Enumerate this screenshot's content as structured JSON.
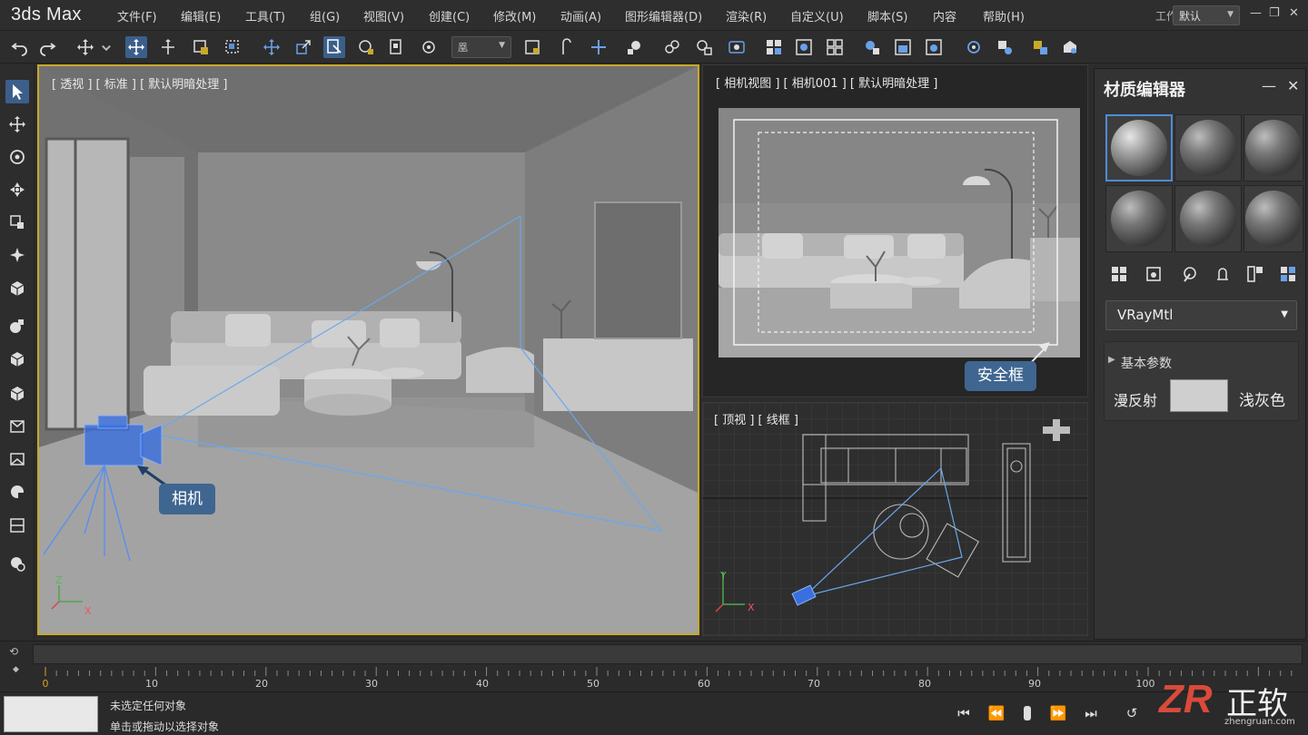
{
  "app": {
    "title": "3ds Max"
  },
  "menus": [
    "文件(F)",
    "编辑(E)",
    "工具(T)",
    "组(G)",
    "视图(V)",
    "创建(C)",
    "修改(M)",
    "动画(A)",
    "图形编辑器(D)",
    "渲染(R)",
    "自定义(U)",
    "脚本(S)",
    "内容",
    "帮助(H)"
  ],
  "workspace": {
    "label": "工作区:",
    "value": "默认"
  },
  "toolbar": {
    "selection_set": "凰"
  },
  "viewports": {
    "perspective": {
      "label": "[ 透视 ] [ 标准 ] [ 默认明暗处理 ]",
      "callout": "相机"
    },
    "camera": {
      "label": "[ 相机视图 ] [ 相机001 ] [ 默认明暗处理 ]",
      "callout": "安全框"
    },
    "top": {
      "label": "[ 顶视 ] [ 线框 ]"
    }
  },
  "axis": {
    "x": "X",
    "y": "Y",
    "z": "Z"
  },
  "material_editor": {
    "title": "材质编辑器",
    "material_type": "VRayMtl",
    "rollout": "基本参数",
    "diffuse_label": "漫反射",
    "diffuse_color_name": "浅灰色",
    "diffuse_color": "#cfcfcf"
  },
  "timeline": {
    "ticks": [
      "0",
      "10",
      "20",
      "30",
      "40",
      "50",
      "60",
      "70",
      "80",
      "90",
      "100"
    ]
  },
  "status": {
    "line1": "未选定任何对象",
    "line2": "单击或拖动以选择对象"
  },
  "watermark": {
    "logo": "ZR",
    "text": "正软",
    "url": "zhengruan.com"
  },
  "colors": {
    "accent": "#3b5f8a",
    "viewport_active_border": "#c8a92a",
    "callout": "#3f6690",
    "camera_blue": "#4d7fe6"
  }
}
